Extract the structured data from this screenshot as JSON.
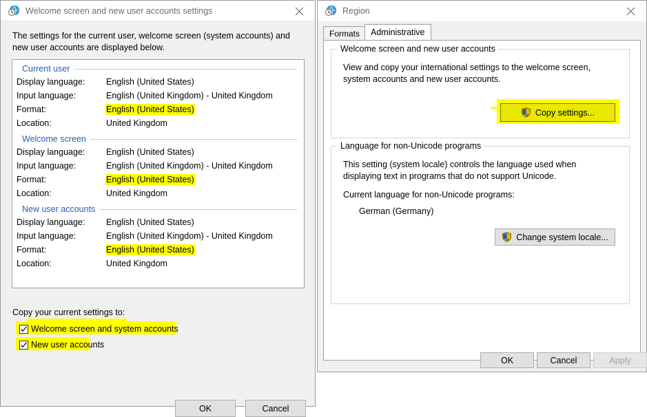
{
  "welcome_dialog": {
    "title": "Welcome screen and new user accounts settings",
    "icon": "region-globe-clock-icon",
    "close_label": "×",
    "intro": "The settings for the current user, welcome screen (system accounts) and new user accounts are displayed below.",
    "field_labels": {
      "display_language": "Display language:",
      "input_language": "Input language:",
      "format": "Format:",
      "location": "Location:"
    },
    "groups": [
      {
        "title": "Current user",
        "display_language": "English (United States)",
        "input_language": "English (United Kingdom) - United Kingdom",
        "format": "English (United States)",
        "format_highlighted": true,
        "location": "United Kingdom"
      },
      {
        "title": "Welcome screen",
        "display_language": "English (United States)",
        "input_language": "English (United Kingdom) - United Kingdom",
        "format": "English (United States)",
        "format_highlighted": true,
        "location": "United Kingdom"
      },
      {
        "title": "New user accounts",
        "display_language": "English (United States)",
        "input_language": "English (United Kingdom) - United Kingdom",
        "format": "English (United States)",
        "format_highlighted": true,
        "location": "United Kingdom"
      }
    ],
    "copy_to_label": "Copy your current settings to:",
    "checkboxes": [
      {
        "label": "Welcome screen and system accounts",
        "checked": true,
        "highlighted": true
      },
      {
        "label": "New user accounts",
        "checked": true,
        "highlighted": true
      }
    ],
    "buttons": {
      "ok": "OK",
      "cancel": "Cancel"
    }
  },
  "region_window": {
    "title": "Region",
    "icon": "region-globe-clock-icon",
    "close_label": "×",
    "tabs": [
      {
        "label": "Formats",
        "active": false
      },
      {
        "label": "Administrative",
        "active": true
      }
    ],
    "welcome_group": {
      "title": "Welcome screen and new user accounts",
      "description": "View and copy your international settings to the welcome screen, system accounts and new user accounts.",
      "copy_settings_button": "Copy settings...",
      "copy_settings_highlighted": true,
      "copy_settings_icon": "uac-shield-icon"
    },
    "nonunicode_group": {
      "title": "Language for non-Unicode programs",
      "description": "This setting (system locale) controls the language used when displaying text in programs that do not support Unicode.",
      "current_label": "Current language for non-Unicode programs:",
      "current_value": "German (Germany)",
      "change_locale_button": "Change system locale...",
      "change_locale_icon": "uac-shield-icon"
    },
    "footer_buttons": {
      "ok": "OK",
      "cancel": "Cancel",
      "apply": "Apply",
      "apply_disabled": true
    }
  },
  "colors": {
    "highlight": "#ffff00",
    "group_header_text": "#2a5db0",
    "title_text": "#6d6d6d",
    "window_bg": "#f0f0f0",
    "panel_bg": "#ffffff"
  }
}
